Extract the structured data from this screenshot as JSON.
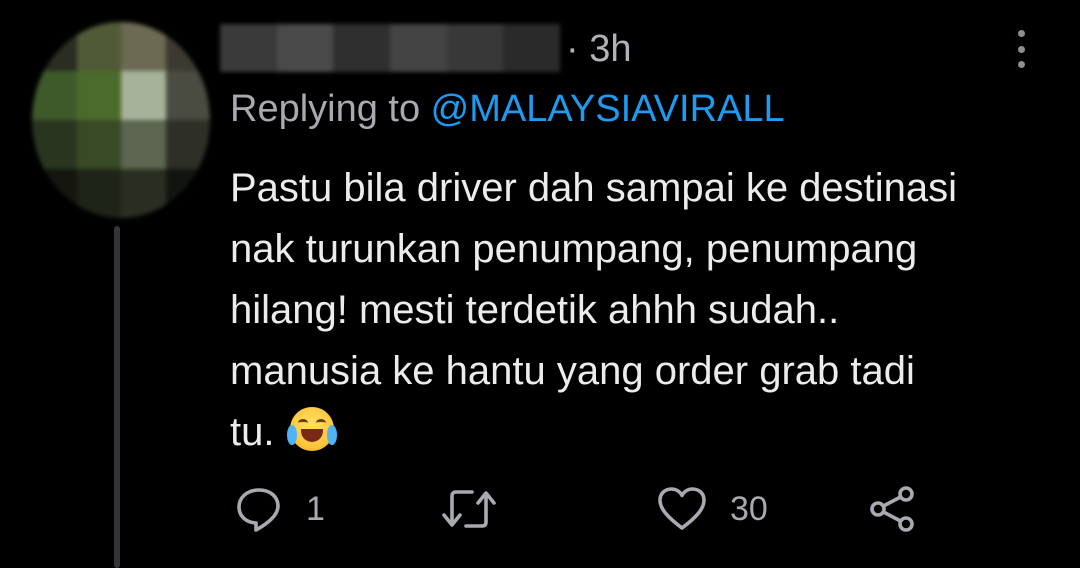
{
  "tweet": {
    "time": "· 3h",
    "reply_prefix": "Replying to ",
    "reply_handle": "@MALAYSIAVIRALL",
    "text": "Pastu bila driver dah sampai ke destinasi\nnak turunkan penumpang, penumpang\nhilang! mesti terdetik ahhh sudah..\nmanusia ke hantu yang order grab tadi\ntu. ",
    "emoji": "face-with-tears-of-joy",
    "accent_color": "#1d9bf0"
  },
  "actions": {
    "reply_count": "1",
    "retweet_count": "",
    "like_count": "30",
    "icons": [
      "reply-icon",
      "retweet-icon",
      "like-icon",
      "share-icon"
    ]
  }
}
